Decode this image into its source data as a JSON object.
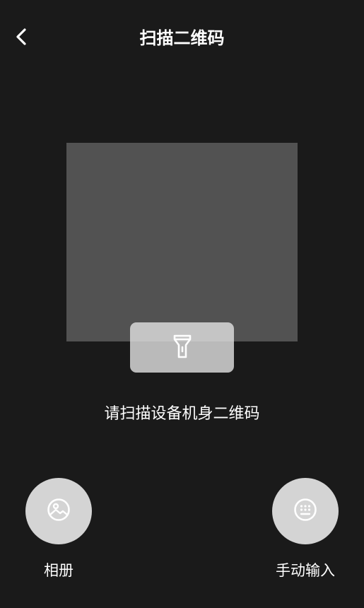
{
  "header": {
    "back_icon": "chevron-left-icon",
    "title": "扫描二维码"
  },
  "scanner": {
    "flashlight_icon": "flashlight-icon",
    "hint": "请扫描设备机身二维码"
  },
  "actions": {
    "album": {
      "icon": "image-icon",
      "label": "相册"
    },
    "manual_input": {
      "icon": "keyboard-icon",
      "label": "手动输入"
    }
  },
  "colors": {
    "background": "#1a1a1a",
    "scan_frame": "#525252",
    "button": "#d4d4d4",
    "text": "#ffffff"
  }
}
